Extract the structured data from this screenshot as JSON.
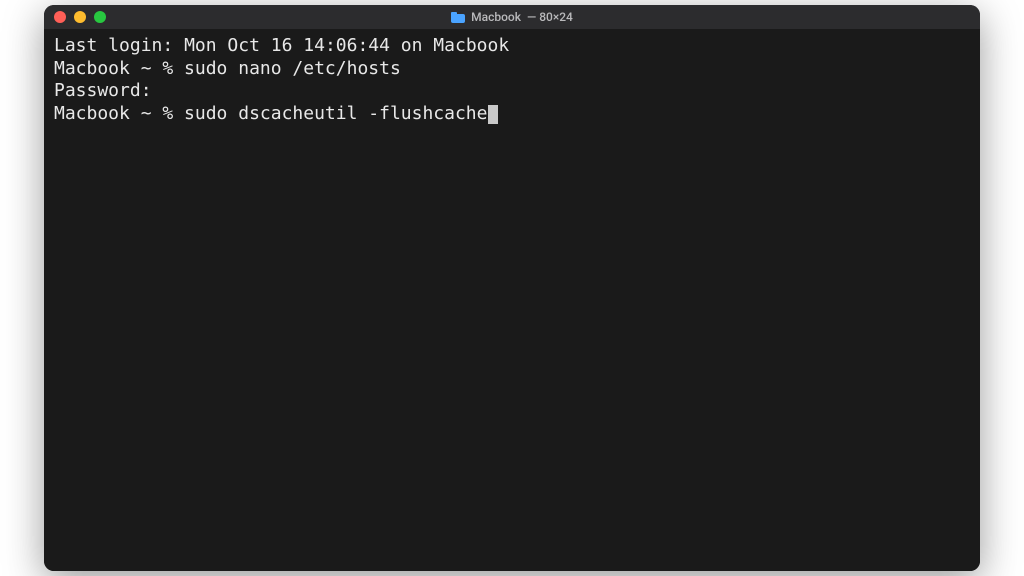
{
  "window": {
    "title_host": "Macbook",
    "title_dims": "— 80×24"
  },
  "terminal": {
    "last_login_label": "Last login:",
    "last_login_value": "Mon Oct 16 14:06:44 on Macbook",
    "prompt1": "Macbook ~ % ",
    "cmd1": "sudo nano /etc/hosts",
    "password_label": "Password:",
    "prompt2": "Macbook ~ % ",
    "cmd2": "sudo dscacheutil -flushcache"
  }
}
